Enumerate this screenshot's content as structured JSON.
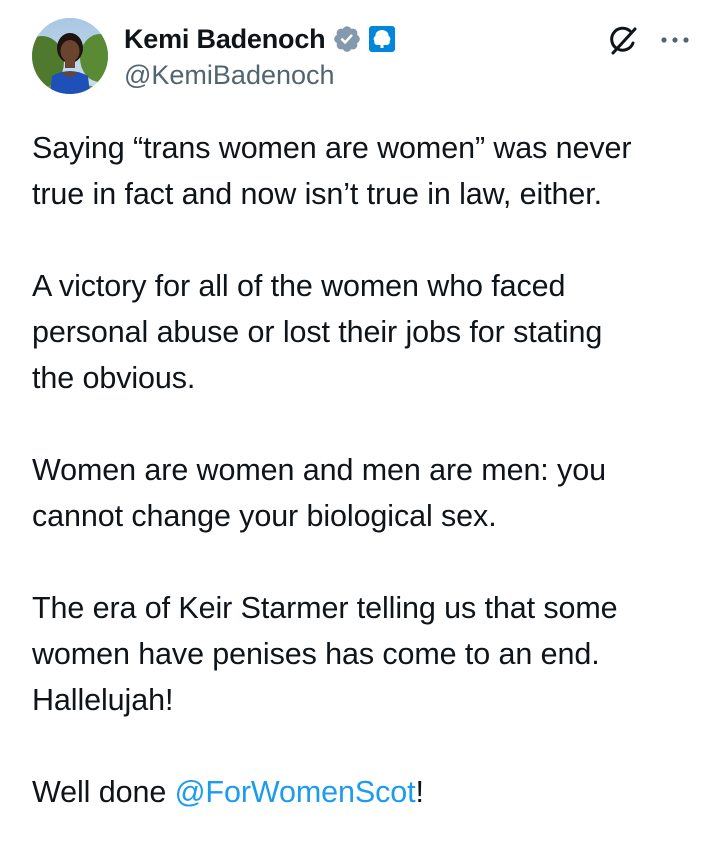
{
  "author": {
    "display_name": "Kemi Badenoch",
    "handle": "@KemiBadenoch",
    "verified_icon": "verified-badge-icon",
    "affiliation_icon": "conservative-tree-logo-icon"
  },
  "header_actions": {
    "grok_icon": "grok-icon",
    "more_icon": "more-options-icon"
  },
  "tweet": {
    "paragraphs": [
      {
        "lines": [
          "Saying “trans women are women” was never",
          "true in fact and now isn’t true in law, either."
        ]
      },
      {
        "lines": [
          "A victory for all of the women who faced",
          "personal abuse or lost their jobs for stating",
          "the obvious."
        ]
      },
      {
        "lines": [
          "Women are women and men are men: you",
          "cannot change your biological sex."
        ]
      },
      {
        "lines": [
          "The era of Keir Starmer telling us that some",
          "women have penises has come to an end.",
          "Hallelujah!"
        ]
      }
    ],
    "last_line": {
      "prefix": "Well done ",
      "mention": "@ForWomenScot",
      "suffix": "!"
    }
  },
  "colors": {
    "text": "#0f1419",
    "secondary": "#536471",
    "link": "#1d9bf0",
    "verified_gray": "#829aab",
    "affiliation_blue": "#0087dc"
  }
}
